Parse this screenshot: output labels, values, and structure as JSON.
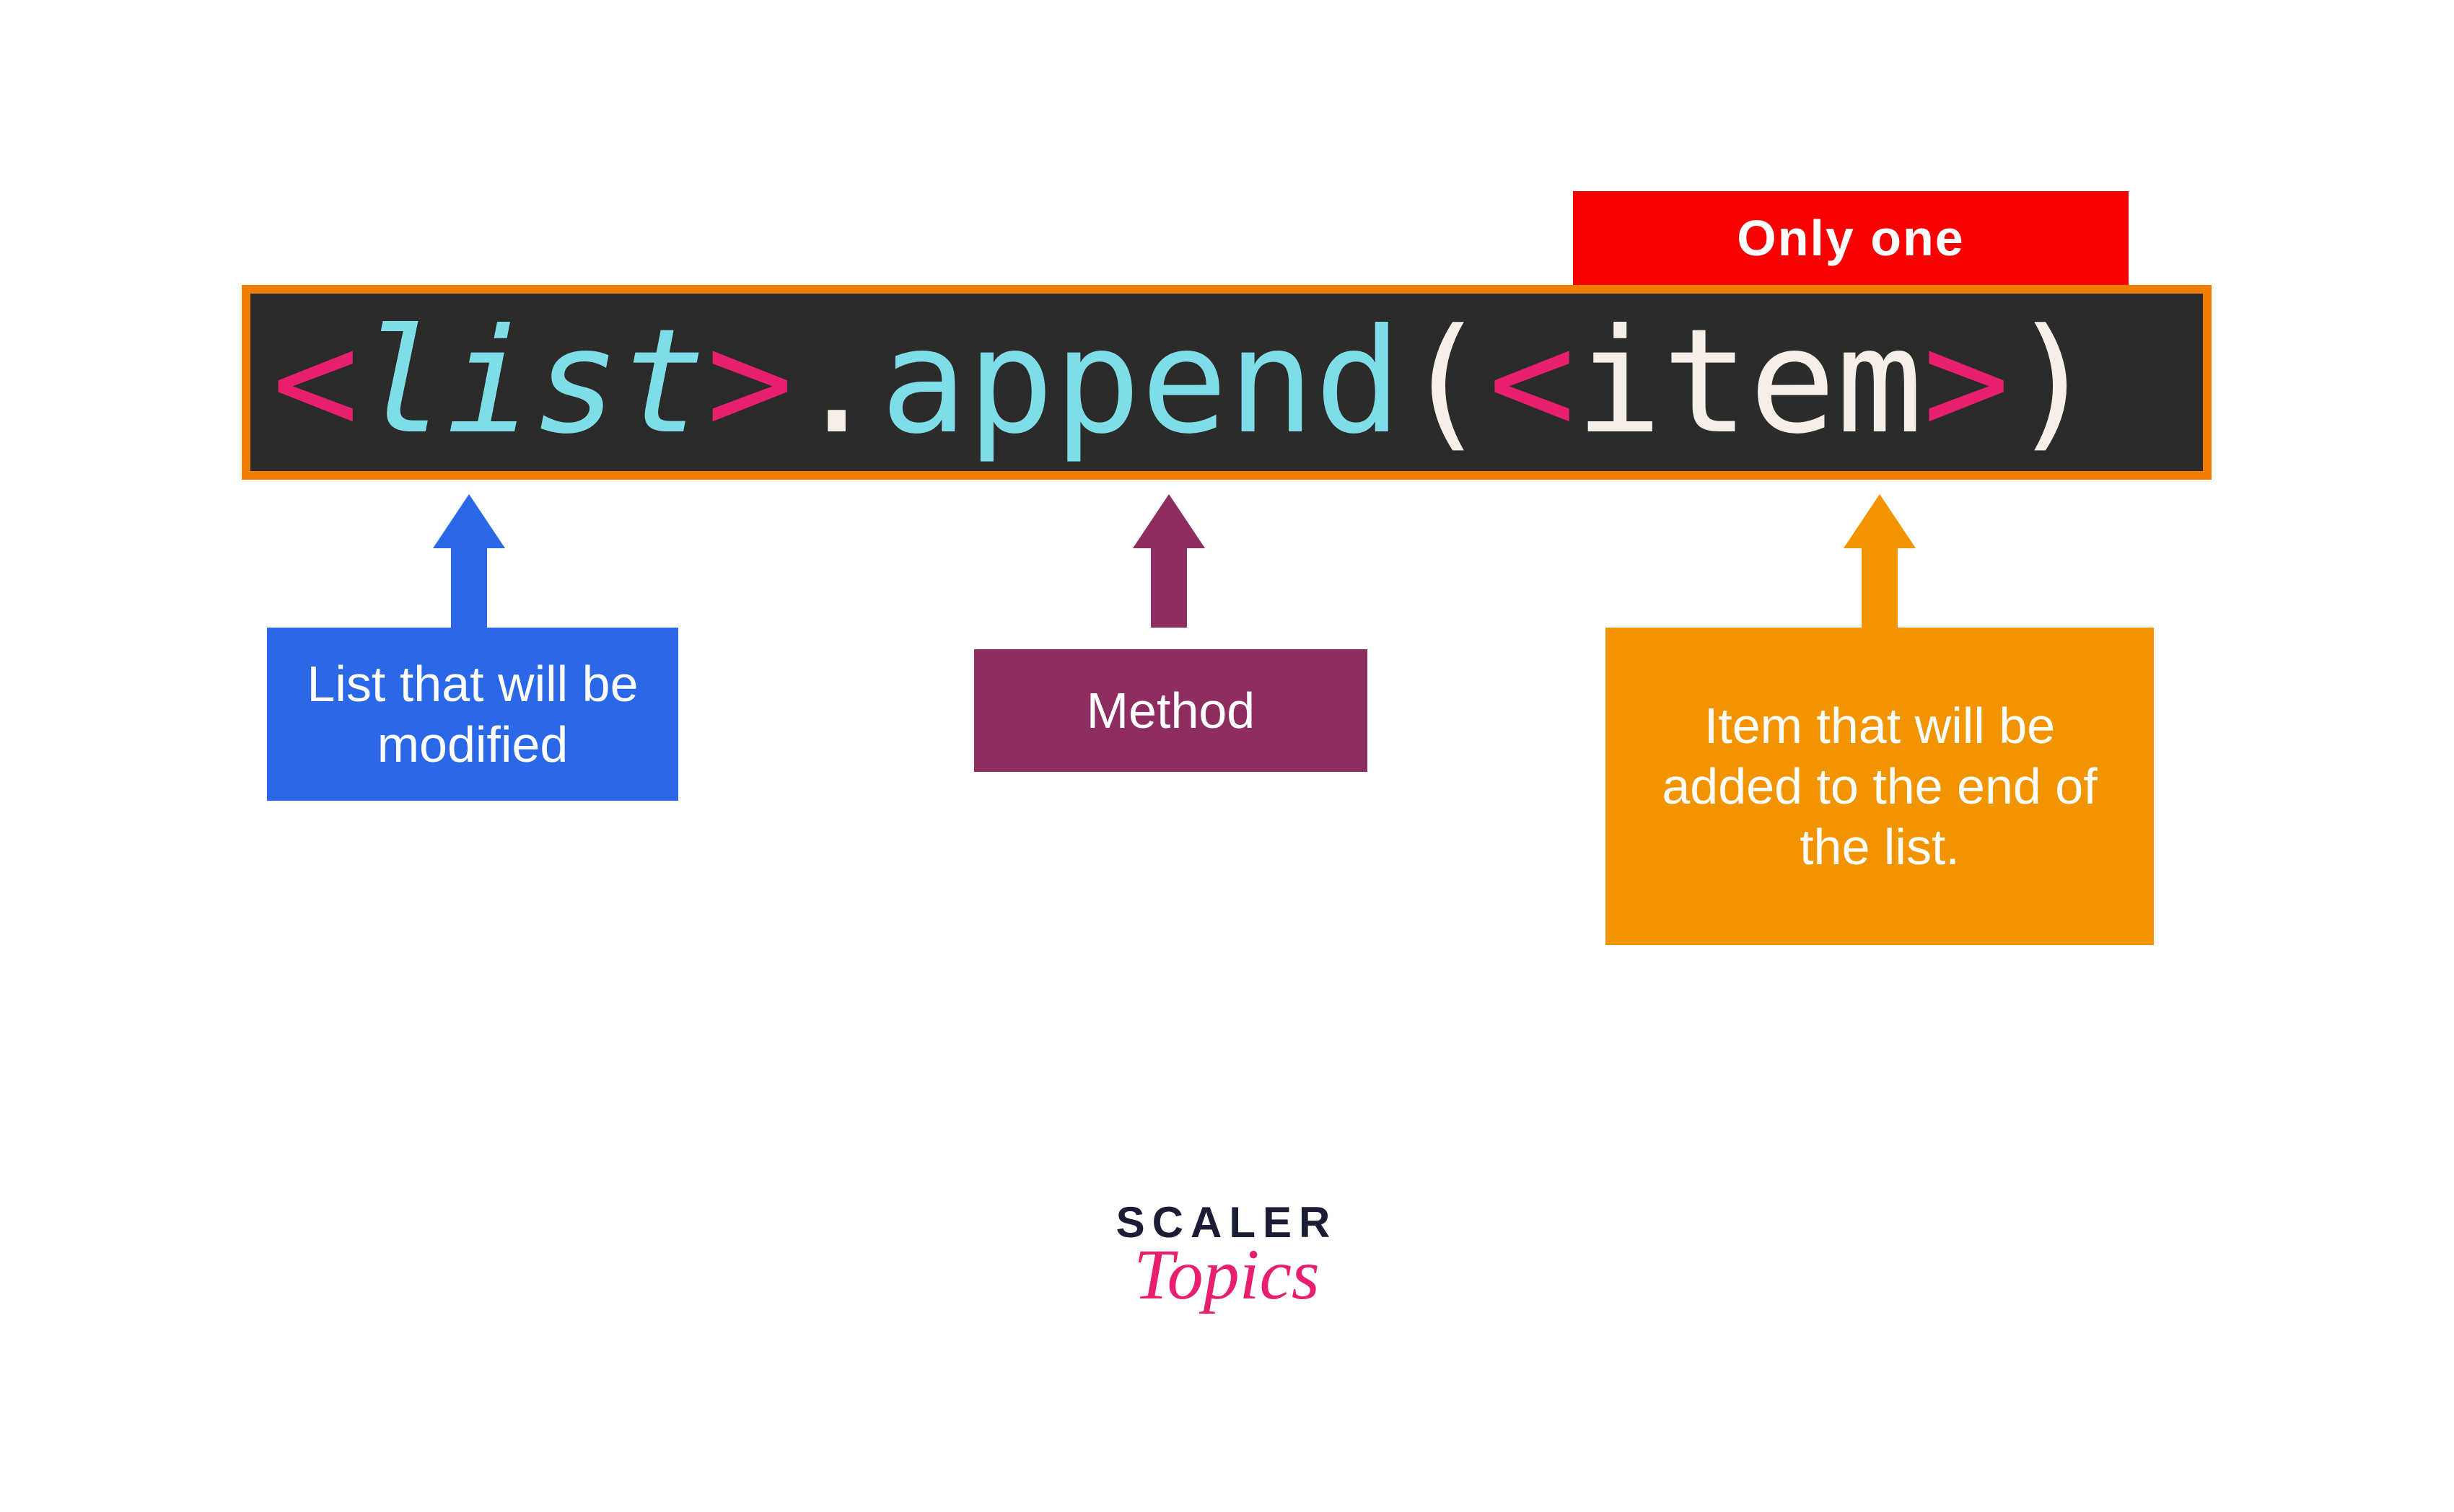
{
  "banner": {
    "only_one": "Only one"
  },
  "code": {
    "open_angle_1": "<",
    "list_word": "list",
    "close_angle_1": ">",
    "dot": ".",
    "method_word": "append",
    "open_paren": "(",
    "open_angle_2": "<",
    "item_word": "item",
    "close_angle_2": ">",
    "close_paren": ")"
  },
  "callouts": {
    "list_desc": "List that will be modified",
    "method_desc": "Method",
    "item_desc": "Item that will be added to the end of the list."
  },
  "logo": {
    "top": "SCALER",
    "bottom": "Topics"
  },
  "colors": {
    "red": "#f80000",
    "orange_border": "#ef7d00",
    "code_bg": "#2b2b2a",
    "bracket_pink": "#e81f6f",
    "cyan": "#7fdde9",
    "cream": "#f5efe7",
    "blue": "#2a68e8",
    "purple": "#8e2d5f",
    "amber": "#f29400",
    "logo_dark": "#1a1d34"
  }
}
